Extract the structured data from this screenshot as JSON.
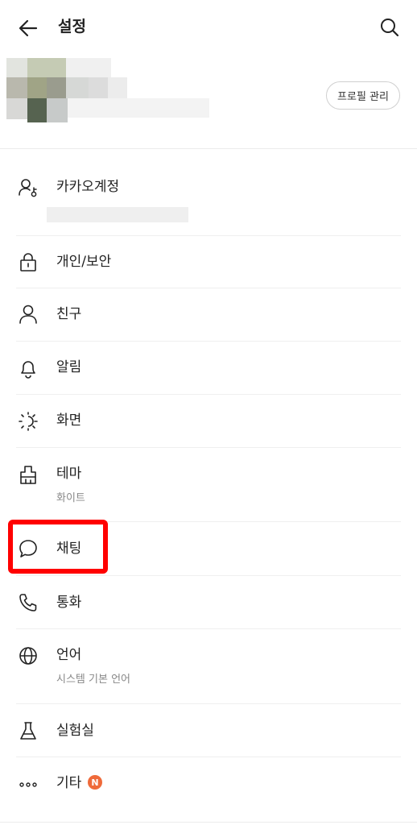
{
  "header": {
    "title": "설정",
    "back_icon": "arrow-left-icon",
    "search_icon": "search-icon"
  },
  "profile": {
    "manage_button": "프로필 관리"
  },
  "menu": [
    {
      "id": "kakao-account",
      "label": "카카오계정",
      "icon": "account-key-icon"
    },
    {
      "id": "privacy",
      "label": "개인/보안",
      "icon": "lock-icon"
    },
    {
      "id": "friends",
      "label": "친구",
      "icon": "person-icon"
    },
    {
      "id": "notifications",
      "label": "알림",
      "icon": "bell-icon"
    },
    {
      "id": "display",
      "label": "화면",
      "icon": "brightness-icon"
    },
    {
      "id": "theme",
      "label": "테마",
      "sub": "화이트",
      "icon": "paint-brush-icon"
    },
    {
      "id": "chat",
      "label": "채팅",
      "icon": "chat-bubble-icon"
    },
    {
      "id": "call",
      "label": "통화",
      "icon": "phone-icon"
    },
    {
      "id": "language",
      "label": "언어",
      "sub": "시스템 기본 언어",
      "icon": "globe-icon"
    },
    {
      "id": "lab",
      "label": "실험실",
      "icon": "flask-icon"
    },
    {
      "id": "etc",
      "label": "기타",
      "icon": "more-dots-icon",
      "badge": "N"
    }
  ],
  "colors": {
    "highlight": "#ff0000",
    "badge": "#ef6a3a",
    "divider": "#efefef"
  }
}
